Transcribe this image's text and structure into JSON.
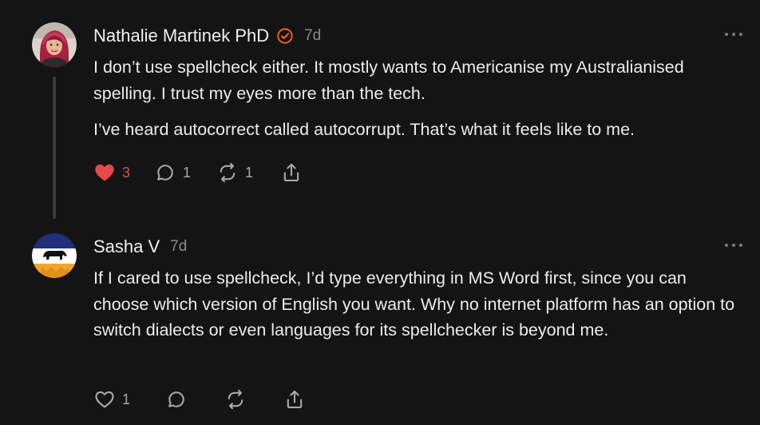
{
  "comments": [
    {
      "author": "Nathalie Martinek PhD",
      "verified": true,
      "timestamp": "7d",
      "paragraphs": [
        "I don’t use spellcheck either. It mostly wants to Americanise my Australianised spelling. I trust my eyes more than the tech.",
        "I’ve heard autocorrect called autocorrupt. That’s what it feels like to me."
      ],
      "actions": {
        "likes": "3",
        "liked": true,
        "replies": "1",
        "restacks": "1"
      }
    },
    {
      "author": "Sasha V",
      "verified": false,
      "timestamp": "7d",
      "paragraphs": [
        "If I cared to use spellcheck, I’d type everything in MS Word first, since you can choose which version of English you want. Why no internet platform has an option to switch dialects or even languages for its spellchecker is beyond me."
      ],
      "actions": {
        "likes": "1",
        "liked": false,
        "replies": "",
        "restacks": ""
      }
    }
  ],
  "icons": {
    "like": "heart-icon",
    "reply": "comment-bubble-icon",
    "restack": "restack-arrows-icon",
    "share": "share-upload-icon",
    "verified": "verified-badge-icon",
    "more": "more-options-icon"
  },
  "colors": {
    "background": "#141414",
    "liked": "#e5484d",
    "verified": "#ff6719",
    "muted": "#8b8b8b"
  }
}
